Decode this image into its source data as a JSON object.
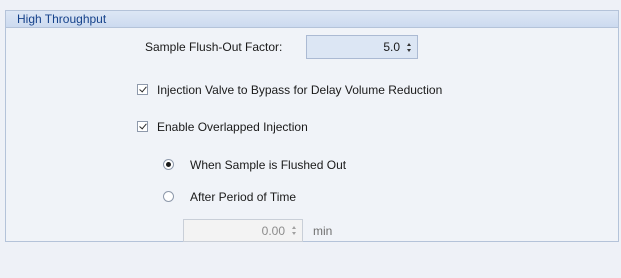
{
  "group": {
    "title": "High Throughput"
  },
  "flush_out": {
    "label": "Sample Flush-Out Factor:",
    "value": "5.0"
  },
  "options": {
    "bypass_label": "Injection Valve to Bypass for Delay Volume Reduction",
    "bypass_checked": true,
    "overlapped_label": "Enable Overlapped Injection",
    "overlapped_checked": true
  },
  "overlap_mode": {
    "flushed_label": "When Sample is Flushed Out",
    "flushed_selected": true,
    "period_label": "After Period of Time",
    "period_selected": false
  },
  "period": {
    "value": "0.00",
    "unit": "min"
  },
  "colors": {
    "header_text": "#15428b",
    "panel_border": "#b4c3d9",
    "spin_active_bg": "#dce6f4"
  }
}
